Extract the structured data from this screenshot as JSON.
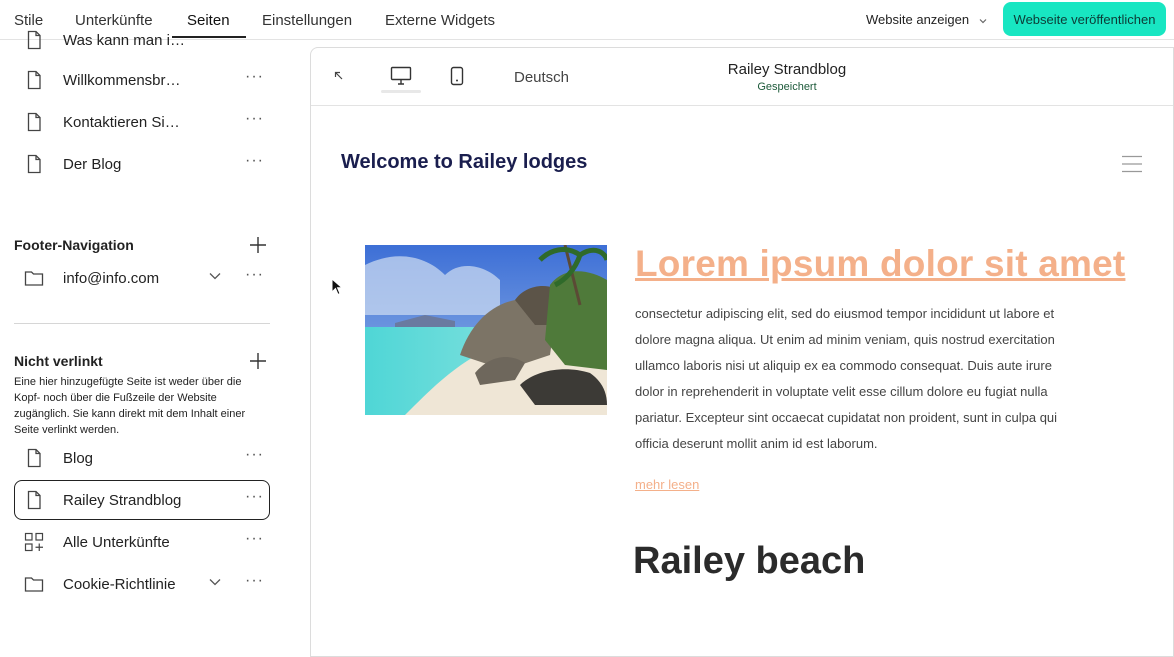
{
  "topnav": {
    "tabs": [
      {
        "label": "Stile"
      },
      {
        "label": "Unterkünfte"
      },
      {
        "label": "Seiten"
      },
      {
        "label": "Einstellungen"
      },
      {
        "label": "Externe Widgets"
      }
    ],
    "active_tab": "Seiten",
    "view_site": "Website anzeigen",
    "publish": "Webseite veröffentlichen"
  },
  "sidebar": {
    "header_items": [
      {
        "label": "Was kann man i…",
        "icon": "page-icon"
      },
      {
        "label": "Willkommensbr…",
        "icon": "page-icon"
      },
      {
        "label": "Kontaktieren Si…",
        "icon": "page-icon"
      },
      {
        "label": "Der Blog",
        "icon": "page-icon"
      }
    ],
    "footer_title": "Footer-Navigation",
    "footer_items": [
      {
        "label": "info@info.com",
        "icon": "folder-icon",
        "expandable": true
      }
    ],
    "unlinked_title": "Nicht verlinkt",
    "unlinked_description": "Eine hier hinzugefügte Seite ist weder über die Kopf- noch über die Fußzeile der Website zugänglich. Sie kann direkt mit dem Inhalt einer Seite verlinkt werden.",
    "unlinked_items": [
      {
        "label": "Blog",
        "icon": "page-icon"
      },
      {
        "label": "Railey Strandblog",
        "icon": "page-icon",
        "selected": true
      },
      {
        "label": "Alle Unterkünfte",
        "icon": "grid-icon"
      },
      {
        "label": "Cookie-Richtlinie",
        "icon": "folder-icon",
        "expandable": true
      }
    ],
    "more": "···"
  },
  "editor": {
    "language": "Deutsch",
    "page_name": "Railey Strandblog",
    "status": "Gespeichert"
  },
  "preview": {
    "site_title": "Welcome to Railey lodges",
    "post_title": "Lorem ipsum dolor sit amet",
    "post_body": "consectetur adipiscing elit, sed do eiusmod tempor incididunt ut labore et dolore magna aliqua. Ut enim ad minim veniam, quis nostrud exercitation ullamco laboris nisi ut aliquip ex ea commodo consequat. Duis aute irure dolor in reprehenderit in voluptate velit esse cillum dolore eu fugiat nulla pariatur. Excepteur sint occaecat cupidatat non proident, sunt in culpa qui officia deserunt mollit anim id est laborum.",
    "read_more": "mehr lesen",
    "section_title": "Railey beach"
  },
  "colors": {
    "accent": "#18e6c2",
    "post_title": "#f4b08a",
    "site_title": "#1a1e4e"
  }
}
